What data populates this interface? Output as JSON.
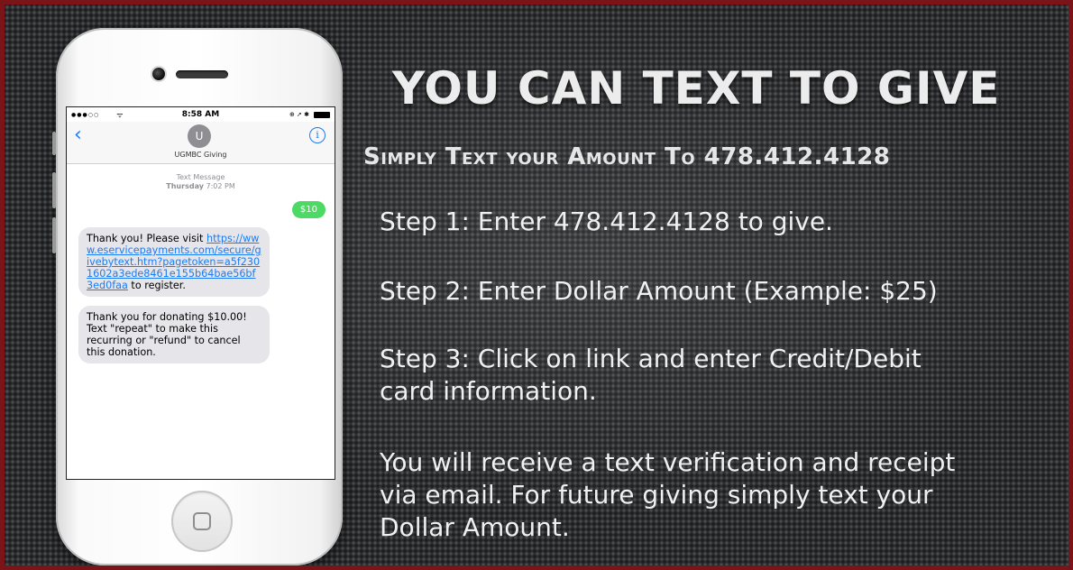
{
  "phone": {
    "status": {
      "carrier_dots": "●●●○○",
      "wifi": "ᯤ",
      "time": "8:58 AM",
      "right_icons": "⊕ ➚ ✱"
    },
    "nav": {
      "back": "‹",
      "avatar_letter": "U",
      "contact_name": "UGMBC Giving",
      "info": "i"
    },
    "meta": {
      "label": "Text Message",
      "day": "Thursday",
      "time": "7:02 PM"
    },
    "messages": {
      "sent_amount": "$10",
      "reply1_before": "Thank you! Please visit ",
      "reply1_link": "https://www.eservicepayments.com/secure/givebytext.htm?pagetoken=a5f2301602a3ede8461e155b64bae56bf3ed0faa",
      "reply1_after": " to register.",
      "reply2": "Thank you for donating $10.00! Text \"repeat\" to make this recurring or \"refund\" to cancel this donation."
    }
  },
  "slide": {
    "title": "YOU CAN TEXT TO GIVE",
    "subtitle": "Simply Text your Amount To 478.412.4128",
    "step1": "Step 1: Enter 478.412.4128 to give.",
    "step2": "Step 2:  Enter Dollar Amount (Example: $25)",
    "step3_line1": "Step 3: Click on link and enter Credit/Debit",
    "step3_line2": "card information.",
    "note_line1": "You will receive a text verification and receipt",
    "note_line2": "via email.  For future giving simply text your",
    "note_line3": "Dollar Amount."
  },
  "colors": {
    "border": "#7a1418",
    "sent_bubble": "#4cd964",
    "link": "#1b7cf5"
  }
}
